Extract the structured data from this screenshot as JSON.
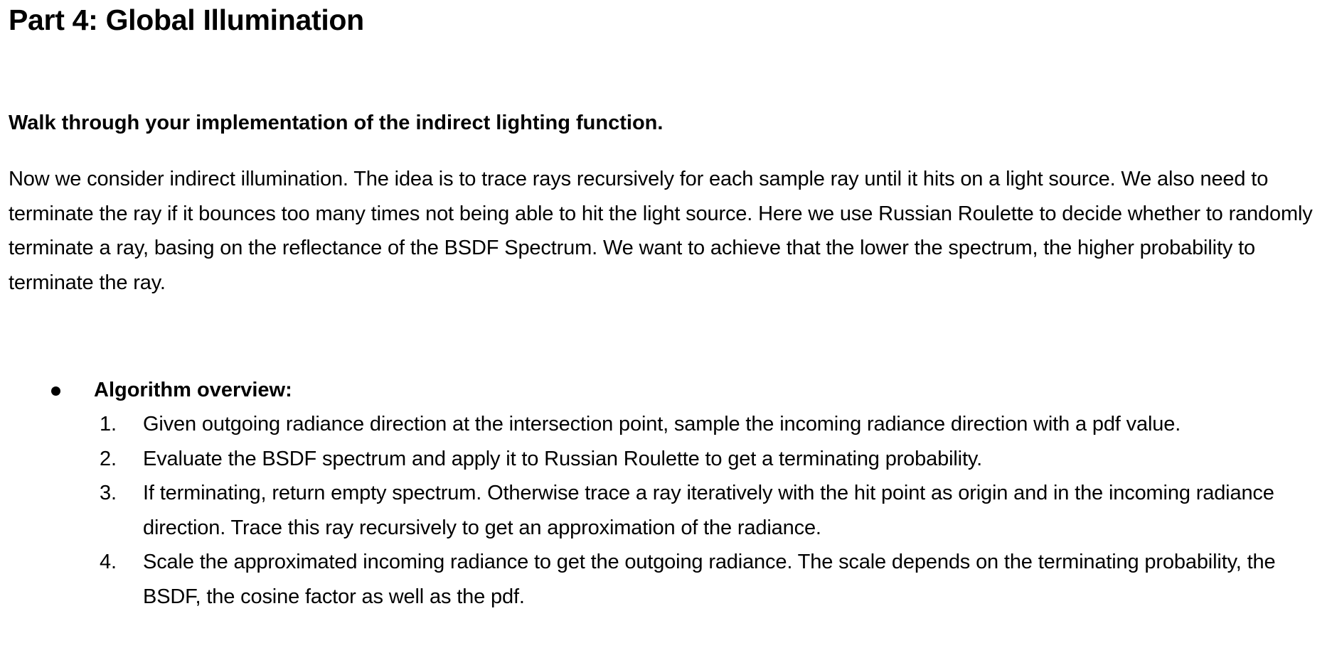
{
  "heading": "Part 4: Global Illumination",
  "question": "Walk through your implementation of the indirect lighting function.",
  "paragraph": "Now we consider indirect illumination. The idea is to trace rays recursively for each sample ray until it hits on a light source. We also need to terminate the ray if it bounces too many times not being able to hit the light source. Here we use Russian Roulette to decide whether to randomly terminate a ray, basing on the reflectance of the BSDF Spectrum. We want to achieve that the lower the spectrum, the higher probability to terminate the ray.",
  "bullet": {
    "label": "Algorithm overview:"
  },
  "steps": [
    {
      "num": "1.",
      "text": "Given outgoing radiance direction at the intersection point, sample the incoming radiance direction with a pdf value."
    },
    {
      "num": "2.",
      "text": "Evaluate the BSDF spectrum and apply it to Russian Roulette to get a terminating probability."
    },
    {
      "num": "3.",
      "text": "If terminating, return empty spectrum. Otherwise trace a ray iteratively with the hit point as origin and in the incoming radiance direction. Trace this ray recursively to get an approximation of the radiance."
    },
    {
      "num": "4.",
      "text": "Scale the approximated incoming radiance to get the outgoing radiance. The scale depends on the terminating probability, the BSDF, the cosine factor as well as the pdf."
    }
  ]
}
